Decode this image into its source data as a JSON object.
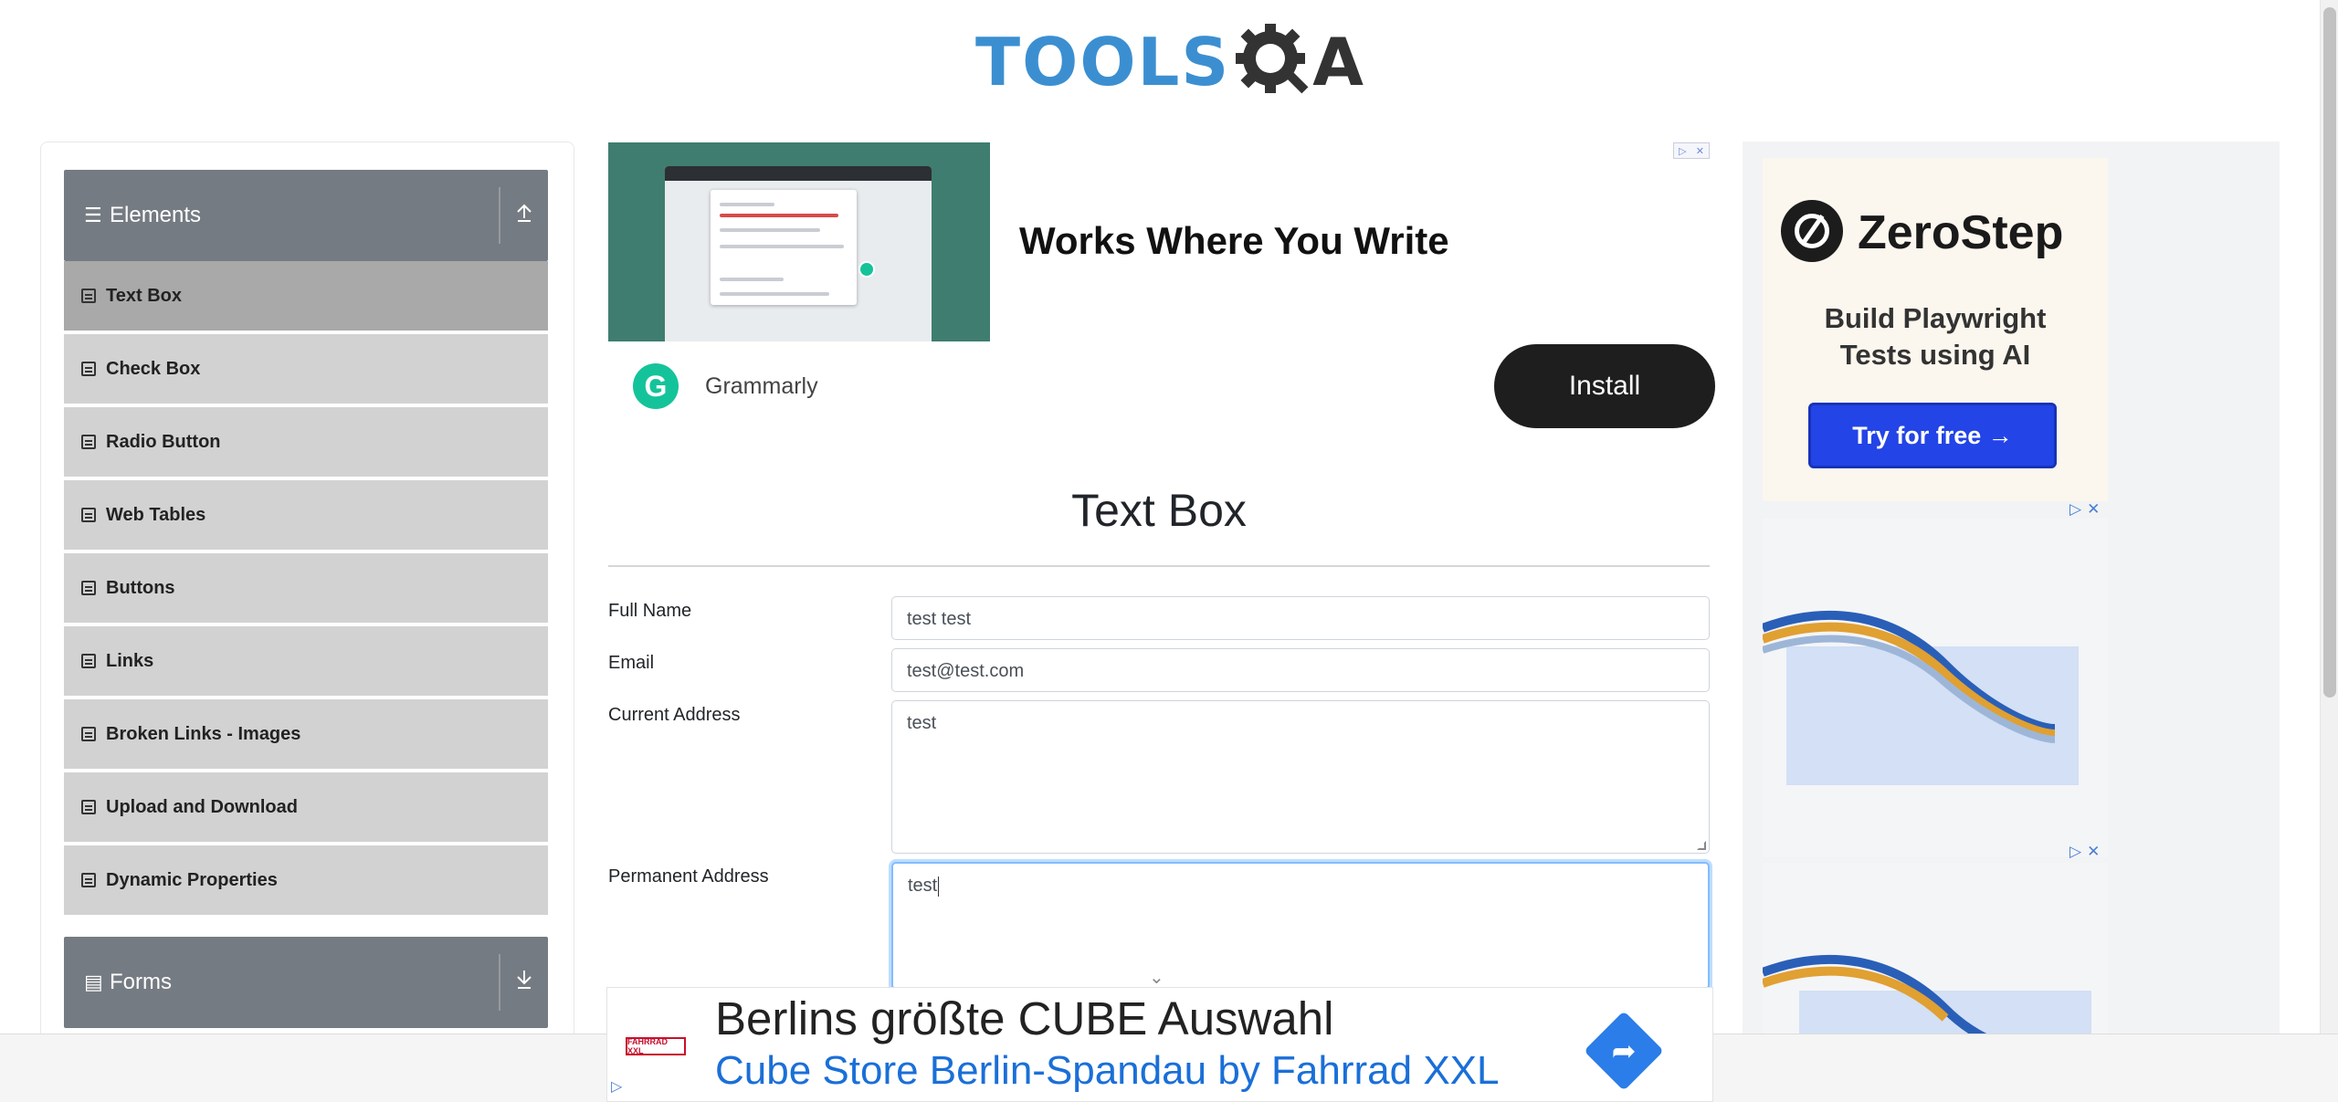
{
  "brand": {
    "logo_text": "TOOLS",
    "logo_suffix": "A",
    "logo_accent": "#3b8fd1"
  },
  "sidebar": {
    "group_elements": {
      "label": "Elements",
      "toggle_icon": "collapse-up-icon"
    },
    "items": [
      {
        "label": "Text Box",
        "active": true
      },
      {
        "label": "Check Box"
      },
      {
        "label": "Radio Button"
      },
      {
        "label": "Web Tables"
      },
      {
        "label": "Buttons"
      },
      {
        "label": "Links"
      },
      {
        "label": "Broken Links - Images"
      },
      {
        "label": "Upload and Download"
      },
      {
        "label": "Dynamic Properties"
      }
    ],
    "group_forms": {
      "label": "Forms",
      "toggle_icon": "expand-down-icon"
    }
  },
  "ad_top": {
    "headline": "Works Where You Write",
    "brand": "Grammarly",
    "cta": "Install",
    "logo_letter": "G"
  },
  "page": {
    "title": "Text Box"
  },
  "form": {
    "full_name": {
      "label": "Full Name",
      "value": "test test"
    },
    "email": {
      "label": "Email",
      "value": "test@test.com"
    },
    "current_address": {
      "label": "Current Address",
      "value": "test"
    },
    "permanent_address": {
      "label": "Permanent Address",
      "value": "test"
    }
  },
  "ad_right": {
    "brand": "ZeroStep",
    "tagline_1": "Build Playwright",
    "tagline_2": "Tests using AI",
    "cta": "Try for free →"
  },
  "ad_bottom": {
    "headline": "Berlins größte CUBE Auswahl",
    "subline": "Cube Store Berlin-Spandau by Fahrrad XXL",
    "logo_text": "FAHRRAD XXL"
  },
  "colors": {
    "sidebar_header": "#757b82",
    "menu_item": "#d2d2d2",
    "menu_item_active": "#a9a9a9",
    "ad_cta_blue": "#2344e6",
    "focus_ring": "#80bdff"
  }
}
